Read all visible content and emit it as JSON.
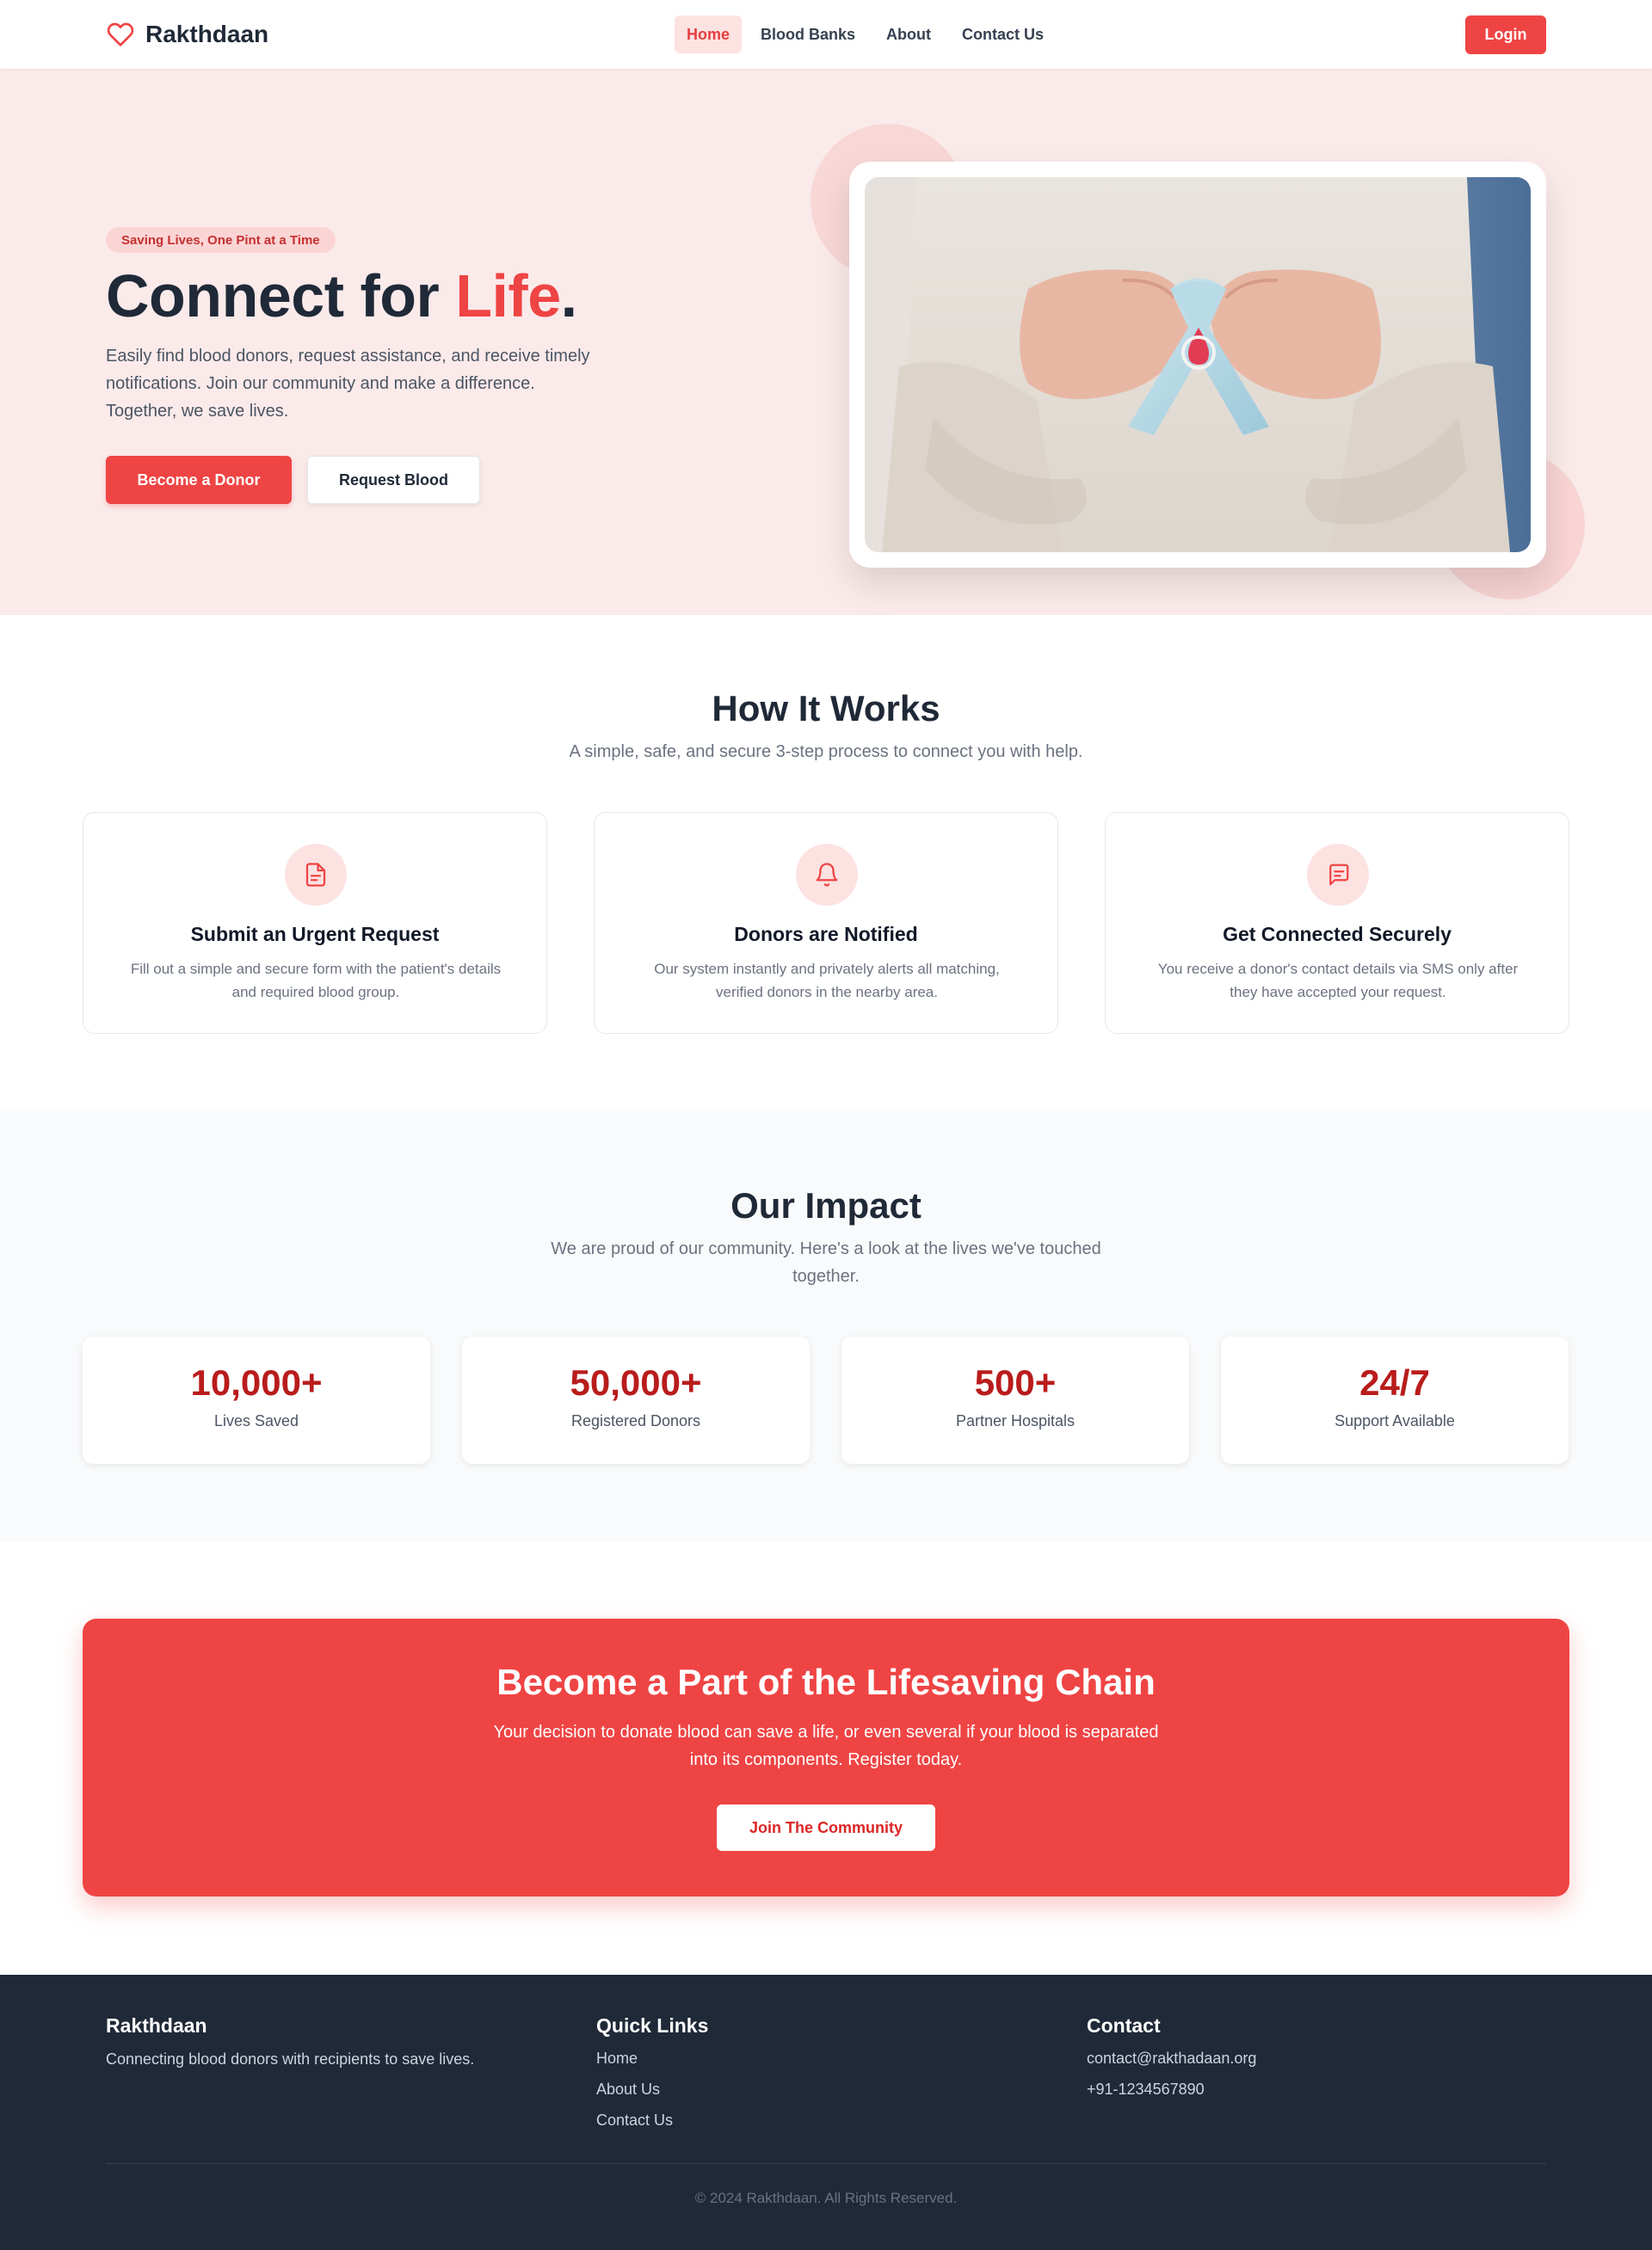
{
  "nav": {
    "brand": "Rakthdaan",
    "links": [
      "Home",
      "Blood Banks",
      "About",
      "Contact Us"
    ],
    "login": "Login",
    "colors": {
      "accent": "#ef4444",
      "active_bg": "#fde2e2"
    }
  },
  "hero": {
    "tag": "Saving Lives, One Pint at a Time",
    "title_part1": "Connect for ",
    "title_accent": "Life",
    "title_end": ".",
    "description": "Easily find blood donors, request assistance, and receive timely notifications. Join our community and make a difference. Together, we save lives.",
    "primary_button": "Become a Donor",
    "secondary_button": "Request Blood",
    "image_icon": "awareness-ribbon-photo"
  },
  "how": {
    "title": "How It Works",
    "subtitle": "A simple, safe, and secure 3-step process to connect you with help.",
    "steps": [
      {
        "icon": "document-icon",
        "title": "Submit an Urgent Request",
        "desc": "Fill out a simple and secure form with the patient's details and required blood group."
      },
      {
        "icon": "bell-icon",
        "title": "Donors are Notified",
        "desc": "Our system instantly and privately alerts all matching, verified donors in the nearby area."
      },
      {
        "icon": "chat-icon",
        "title": "Get Connected Securely",
        "desc": "You receive a donor's contact details via SMS only after they have accepted your request."
      }
    ]
  },
  "impact": {
    "title": "Our Impact",
    "subtitle": "We are proud of our community. Here's a look at the lives we've touched together.",
    "stats": [
      {
        "value": "10,000+",
        "label": "Lives Saved"
      },
      {
        "value": "50,000+",
        "label": "Registered Donors"
      },
      {
        "value": "500+",
        "label": "Partner Hospitals"
      },
      {
        "value": "24/7",
        "label": "Support Available"
      }
    ]
  },
  "cta": {
    "title": "Become a Part of the Lifesaving Chain",
    "description": "Your decision to donate blood can save a life, or even several if your blood is separated into its components. Register today.",
    "button": "Join The Community"
  },
  "footer": {
    "brand": "Rakthdaan",
    "tagline": "Connecting blood donors with recipients to save lives.",
    "quick_links_title": "Quick Links",
    "quick_links": [
      "Home",
      "About Us",
      "Contact Us"
    ],
    "contact_title": "Contact",
    "email": "contact@rakthadaan.org",
    "phone": "+91-1234567890",
    "copyright": "© 2024 Rakthdaan. All Rights Reserved."
  }
}
